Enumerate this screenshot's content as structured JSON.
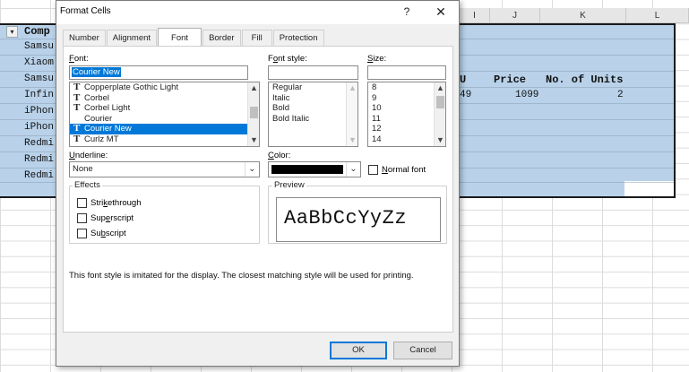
{
  "sheet": {
    "columns": [
      {
        "label": "I"
      },
      {
        "label": "J"
      },
      {
        "label": "K"
      },
      {
        "label": "L"
      }
    ],
    "rows_partial": [
      "Comp",
      "Samsu",
      "Xiaom",
      "Samsu",
      "Infin",
      "iPhon",
      "iPhon",
      "Redmi",
      "Redmi",
      "Redmi"
    ],
    "right_cells": {
      "header_u": "U",
      "header_price": "Price",
      "header_units": "No. of Units",
      "val_49": "49",
      "val_price": "1099",
      "val_units": "2"
    }
  },
  "dialog": {
    "title": "Format Cells",
    "help_glyph": "?",
    "close_glyph": "✕",
    "tabs": [
      "Number",
      "Alignment",
      "Font",
      "Border",
      "Fill",
      "Protection"
    ],
    "active_tab": "Font",
    "font": {
      "label": "Font:",
      "value": "Courier New",
      "list": [
        {
          "name": "Copperplate Gothic Light",
          "tt": true
        },
        {
          "name": "Corbel",
          "tt": true
        },
        {
          "name": "Corbel Light",
          "tt": true
        },
        {
          "name": "Courier",
          "tt": false
        },
        {
          "name": "Courier New",
          "tt": true,
          "selected": true
        },
        {
          "name": "Curlz MT",
          "tt": true
        }
      ]
    },
    "font_style": {
      "label": "Font style:",
      "value": "",
      "list": [
        "Regular",
        "Italic",
        "Bold",
        "Bold Italic"
      ]
    },
    "size": {
      "label": "Size:",
      "value": "",
      "list": [
        "8",
        "9",
        "10",
        "11",
        "12",
        "14"
      ]
    },
    "underline": {
      "label": "Underline:",
      "value": "None"
    },
    "color": {
      "label": "Color:",
      "value_color": "#000000"
    },
    "normal_font_label": "Normal font",
    "effects": {
      "title": "Effects",
      "strikethrough": "Strikethrough",
      "superscript": "Superscript",
      "subscript": "Subscript"
    },
    "preview": {
      "title": "Preview",
      "text": "AaBbCcYyZz"
    },
    "note": "This font style is imitated for the display.  The closest matching style will be used for printing.",
    "ok_label": "OK",
    "cancel_label": "Cancel"
  },
  "colors": {
    "selection": "#b9d2ea",
    "list_selected": "#0078d7"
  }
}
